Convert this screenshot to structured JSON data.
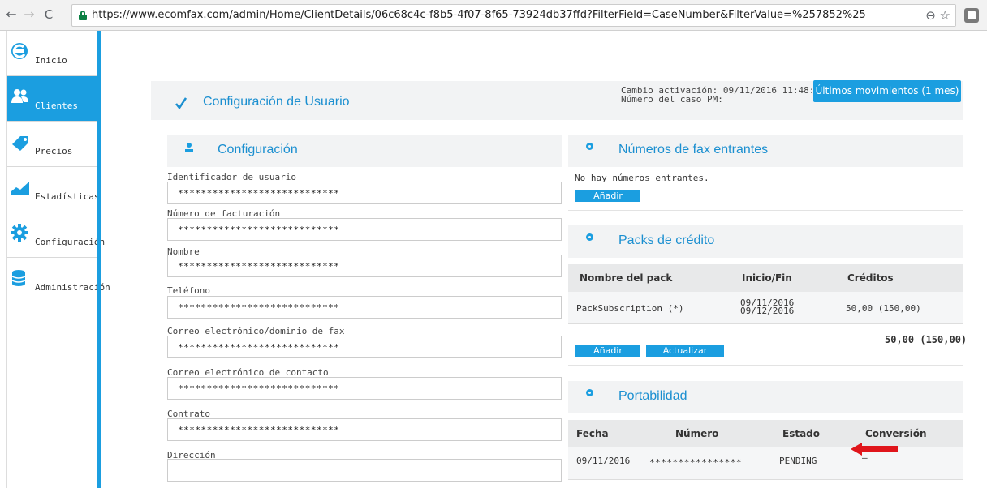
{
  "browser": {
    "back": "←",
    "forward": "→",
    "reload": "C",
    "url": "https://www.ecomfax.com/admin/Home/ClientDetails/06c68c4c-f8b5-4f07-8f65-73924db37ffd?FilterField=CaseNumber&FilterValue=%257852%25",
    "zoom": "⊖",
    "star": "☆"
  },
  "sidebar": {
    "items": [
      {
        "label": "Inicio",
        "icon": "ecomfax-logo-icon"
      },
      {
        "label": "Clientes",
        "icon": "users-icon"
      },
      {
        "label": "Precios",
        "icon": "price-tag-icon"
      },
      {
        "label": "Estadísticas",
        "icon": "chart-icon"
      },
      {
        "label": "Configuración",
        "icon": "gear-icon"
      },
      {
        "label": "Administración",
        "icon": "database-icon"
      }
    ],
    "active_color": "#1b9ee0"
  },
  "header": {
    "title": "Configuración de Usuario",
    "activation_line1": "Cambio activación: 09/11/2016 11:48:04",
    "activation_line2": "Número del caso PM:",
    "movements_button": "Últimos movimientos (1 mes)"
  },
  "config": {
    "title": "Configuración",
    "fields": [
      {
        "label": "Identificador de usuario",
        "value": "****************************"
      },
      {
        "label": "Número de facturación",
        "value": "****************************"
      },
      {
        "label": "Nombre",
        "value": "****************************"
      },
      {
        "label": "Teléfono",
        "value": "****************************"
      },
      {
        "label": "Correo electrónico/dominio de fax",
        "value": "****************************"
      },
      {
        "label": "Correo electrónico de contacto",
        "value": "****************************"
      },
      {
        "label": "Contrato",
        "value": "****************************"
      },
      {
        "label": "Dirección",
        "value": ""
      }
    ]
  },
  "fax_numbers": {
    "title": "Números de fax entrantes",
    "empty_text": "No hay números entrantes.",
    "add_button": "Añadir"
  },
  "credit_packs": {
    "title": "Packs de crédito",
    "columns": [
      "Nombre del pack",
      "Inicio/Fin",
      "Créditos"
    ],
    "rows": [
      {
        "name": "PackSubscription (*)",
        "start": "09/11/2016",
        "end": "09/12/2016",
        "credits": "50,00 (150,00)"
      }
    ],
    "total": "50,00 (150,00)",
    "add_button": "Añadir",
    "update_button": "Actualizar"
  },
  "portability": {
    "title": "Portabilidad",
    "columns": [
      "Fecha",
      "Número",
      "Estado",
      "Conversión"
    ],
    "rows": [
      {
        "date": "09/11/2016",
        "number": "****************",
        "status": "PENDING",
        "conversion": "—"
      }
    ]
  },
  "colors": {
    "accent": "#1b9ee0",
    "title_blue": "#1b8fd0",
    "check_green": "#1b8fd0",
    "arrow_red": "#e0151b"
  }
}
